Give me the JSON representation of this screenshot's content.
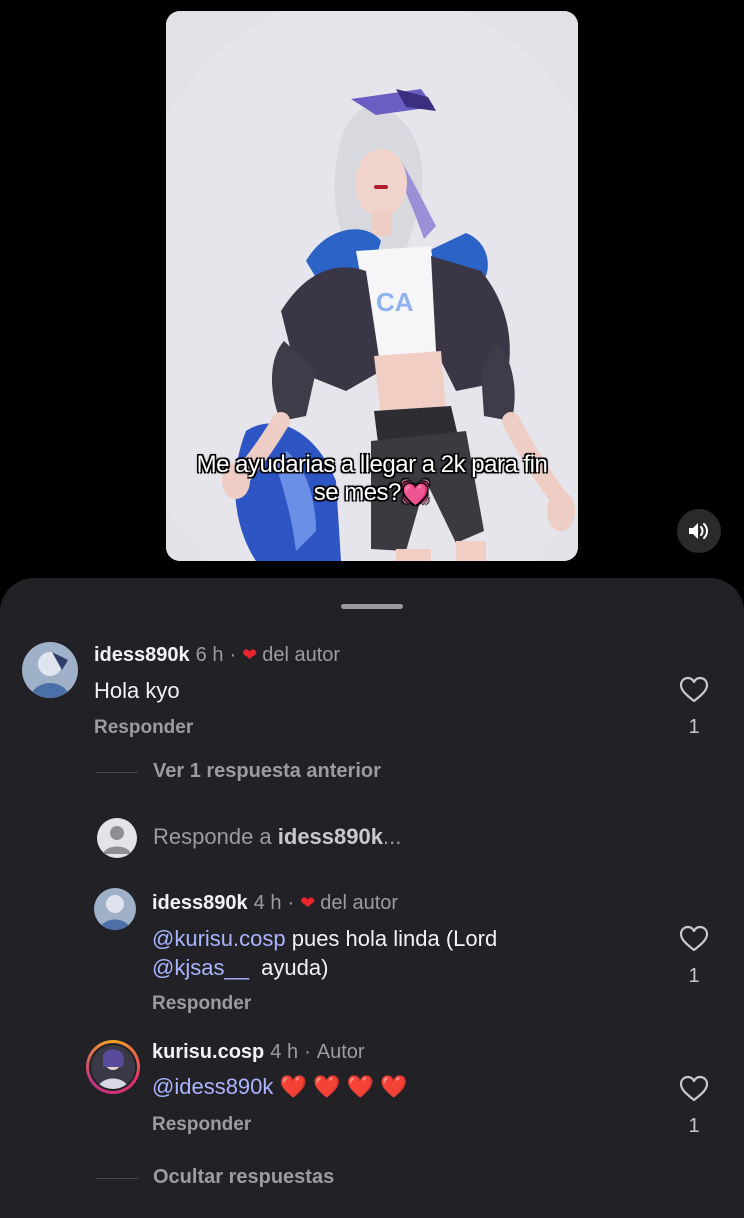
{
  "video": {
    "caption_line1": "Me ayudarias a llegar a 2k para fin",
    "caption_line2": "se mes?💓"
  },
  "comments": [
    {
      "username": "idess890k",
      "time": "6 h",
      "dot": "·",
      "heart": "❤",
      "badge": "del autor",
      "text": "Hola kyo",
      "reply_label": "Responder",
      "likes": "1"
    }
  ],
  "thread": {
    "view_previous": "Ver 1 respuesta anterior",
    "respond_prefix": "Responde a ",
    "respond_user": "idess890k",
    "respond_suffix": "..."
  },
  "replies": [
    {
      "username": "idess890k",
      "time": "4 h",
      "dot": "·",
      "heart": "❤",
      "badge": "del autor",
      "mention1": "@kurisu.cosp",
      "text1": " pues hola linda (Lord",
      "mention2": "@kjsas__",
      "text2": "  ayuda)",
      "reply_label": "Responder",
      "likes": "1"
    },
    {
      "username": "kurisu.cosp",
      "time": "4 h",
      "dot": "·",
      "badge": "Autor",
      "mention1": "@idess890k",
      "text1": " ❤️ ❤️ ❤️ ❤️",
      "reply_label": "Responder",
      "likes": "1"
    }
  ],
  "footer": {
    "hide_replies": "Ocultar respuestas"
  },
  "colors": {
    "sheet_bg": "#222226",
    "mention": "#a9b4ff",
    "heart": "#e8262e"
  }
}
